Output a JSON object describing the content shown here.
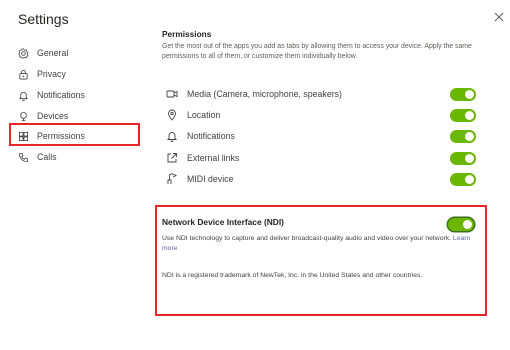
{
  "window": {
    "title": "Settings",
    "close_icon": "close-icon"
  },
  "sidebar": {
    "items": [
      {
        "label": "General",
        "icon": "gear-icon"
      },
      {
        "label": "Privacy",
        "icon": "lock-icon"
      },
      {
        "label": "Notifications",
        "icon": "bell-icon"
      },
      {
        "label": "Devices",
        "icon": "device-icon"
      },
      {
        "label": "Permissions",
        "icon": "grid-icon",
        "selected": true
      },
      {
        "label": "Calls",
        "icon": "phone-icon"
      }
    ]
  },
  "permissions": {
    "title": "Permissions",
    "description": "Get the most out of the apps you add as tabs by allowing them to access your device. Apply the same permissions to all of them, or customize them individually below.",
    "items": [
      {
        "label": "Media (Camera, microphone, speakers)",
        "icon": "camera-icon",
        "enabled": true
      },
      {
        "label": "Location",
        "icon": "location-icon",
        "enabled": true
      },
      {
        "label": "Notifications",
        "icon": "bell-icon",
        "enabled": true
      },
      {
        "label": "External links",
        "icon": "external-link-icon",
        "enabled": true
      },
      {
        "label": "MIDI device",
        "icon": "midi-icon",
        "enabled": true
      }
    ]
  },
  "ndi": {
    "title": "Network Device Interface (NDI)",
    "description": "Use NDI technology to capture and deliver broadcast-quality audio and video over your network.",
    "learn_more": "Learn more",
    "note": "NDI is a registered trademark of NewTek, Inc. in the United States and other countries.",
    "enabled": true
  },
  "colors": {
    "toggle_on": "#6bb700",
    "highlight": "#e5262b",
    "link": "#6264a7"
  }
}
